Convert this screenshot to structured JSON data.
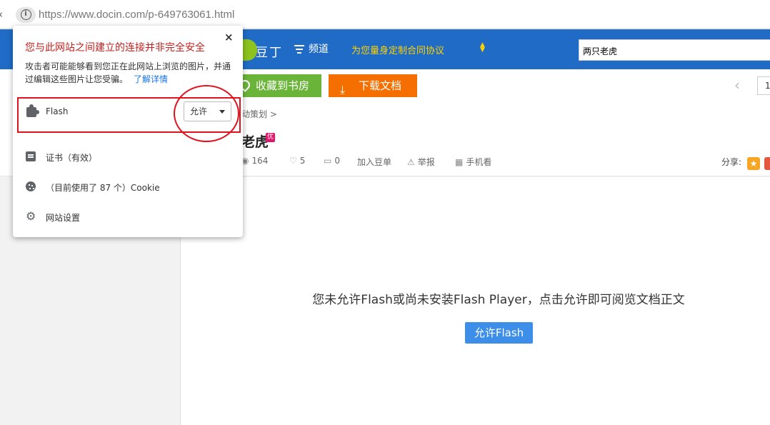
{
  "browser": {
    "back_glyph": "‹",
    "url": "https://www.docin.com/p-649763061.html",
    "info_icon": "info-icon"
  },
  "header": {
    "logo_text": "豆丁",
    "nav_channel": "频道",
    "nav_custom": "为您量身定制合同协议",
    "search_value": "两只老虎",
    "brand_color": "#1f6bc6"
  },
  "toolbar": {
    "collect_label": "收藏到书房",
    "download_label": "下载文档",
    "page_num": "1"
  },
  "doc": {
    "breadcrumb": "动策划 >",
    "title": "老虎",
    "badge": "优",
    "views": "164",
    "likes": "5",
    "comments": "0",
    "add_douban": "加入豆单",
    "report": "举报",
    "mobile": "手机看",
    "share_label": "分享:"
  },
  "content": {
    "flash_message": "您未允许Flash或尚未安装Flash Player，点击允许即可阅览文档正文",
    "allow_flash_button": "允许Flash"
  },
  "popup": {
    "close": "×",
    "title": "您与此网站之间建立的连接并非完全安全",
    "description": "攻击者可能能够看到您正在此网站上浏览的图片，并通过编辑这些图片让您受骗。",
    "learn_more": "了解详情",
    "flash_label": "Flash",
    "flash_permission": "允许",
    "certificate": "证书（有效）",
    "cookies": "（目前使用了 87 个）Cookie",
    "site_settings": "网站设置"
  }
}
